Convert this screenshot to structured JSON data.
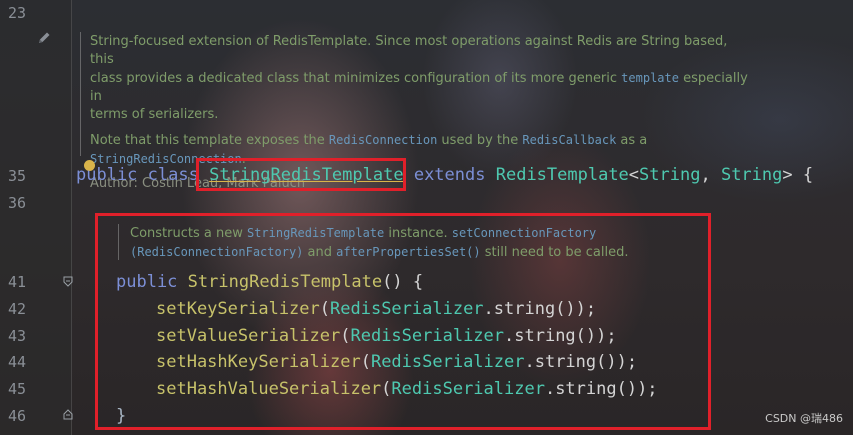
{
  "gutter": {
    "line_numbers": [
      "23",
      "35",
      "36",
      "41",
      "42",
      "43",
      "44",
      "45",
      "46"
    ]
  },
  "class_doc": {
    "p1": "String-focused extension of RedisTemplate. Since most operations against Redis are String based, this",
    "p2a": "class provides a dedicated class that minimizes configuration of its more generic ",
    "p2code": "template",
    "p2b": " especially in",
    "p3": "terms of serializers.",
    "note_a": "Note that this template exposes the ",
    "note_code1": "RedisConnection",
    "note_b": " used by the ",
    "note_code2": "RedisCallback",
    "note_c": " as a",
    "note_code3": "StringRedisConnection",
    "note_d": ".",
    "author": "Author: Costin Leau, Mark Paluch"
  },
  "class_decl": {
    "kw_public": "public",
    "kw_class": "class",
    "class_name": "StringRedisTemplate",
    "kw_extends": "extends",
    "parent": "RedisTemplate",
    "lt": "<",
    "t1": "String",
    "comma": ", ",
    "t2": "String",
    "tail": "> {"
  },
  "ctor_doc": {
    "a": "Constructs a new ",
    "code1": "StringRedisTemplate",
    "b": " instance. ",
    "code2": "setConnectionFactory",
    "code3": "(RedisConnectionFactory)",
    "c": " and ",
    "code4": "afterPropertiesSet()",
    "d": " still need to be called."
  },
  "ctor": {
    "kw_public": "public",
    "name": "StringRedisTemplate",
    "sig_tail": "() {",
    "calls": [
      {
        "fn": "setKeySerializer",
        "arg_cls": "RedisSerializer",
        "rest": ".string());"
      },
      {
        "fn": "setValueSerializer",
        "arg_cls": "RedisSerializer",
        "rest": ".string());"
      },
      {
        "fn": "setHashKeySerializer",
        "arg_cls": "RedisSerializer",
        "rest": ".string());"
      },
      {
        "fn": "setHashValueSerializer",
        "arg_cls": "RedisSerializer",
        "rest": ".string());"
      }
    ],
    "close": "}"
  },
  "watermark": "CSDN @瑞486",
  "colors": {
    "keyword": "#7c8fd6",
    "type": "#4ec9b0",
    "method": "#c7c26a",
    "doc_text": "#7f9d6a",
    "highlight_box": "#e0202a"
  },
  "icons": [
    "edit-pencil-icon",
    "intention-bulb-icon",
    "fold-marker-icon"
  ]
}
